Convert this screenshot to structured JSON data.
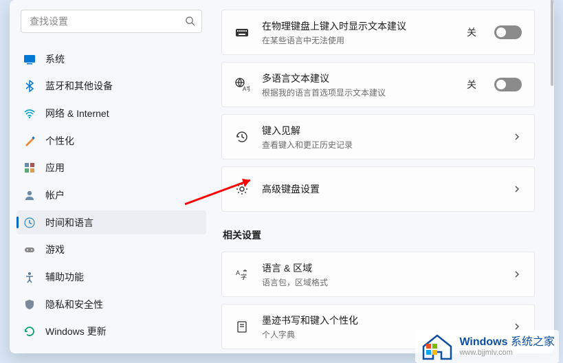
{
  "search": {
    "placeholder": "查找设置"
  },
  "sidebar": {
    "items": [
      {
        "label": "系统"
      },
      {
        "label": "蓝牙和其他设备"
      },
      {
        "label": "网络 & Internet"
      },
      {
        "label": "个性化"
      },
      {
        "label": "应用"
      },
      {
        "label": "帐户"
      },
      {
        "label": "时间和语言"
      },
      {
        "label": "游戏"
      },
      {
        "label": "辅助功能"
      },
      {
        "label": "隐私和安全性"
      },
      {
        "label": "Windows 更新"
      }
    ]
  },
  "cards": {
    "textSuggestions": {
      "title": "在物理键盘上键入时显示文本建议",
      "sub": "在某些语言中无法使用",
      "state": "关"
    },
    "multilingual": {
      "title": "多语言文本建议",
      "sub": "根据我的语言首选项显示文本建议",
      "state": "关"
    },
    "insights": {
      "title": "键入见解",
      "sub": "查看键入和更正历史记录"
    },
    "advanced": {
      "title": "高级键盘设置"
    }
  },
  "related": {
    "heading": "相关设置",
    "langRegion": {
      "title": "语言 & 区域",
      "sub": "语言包，区域格式"
    },
    "ink": {
      "title": "墨迹书写和键入个性化",
      "sub": "个人字典"
    }
  },
  "watermark": {
    "brand": "Windows",
    "suffix": "系统之家",
    "url": "www.bjjmlv.com"
  }
}
